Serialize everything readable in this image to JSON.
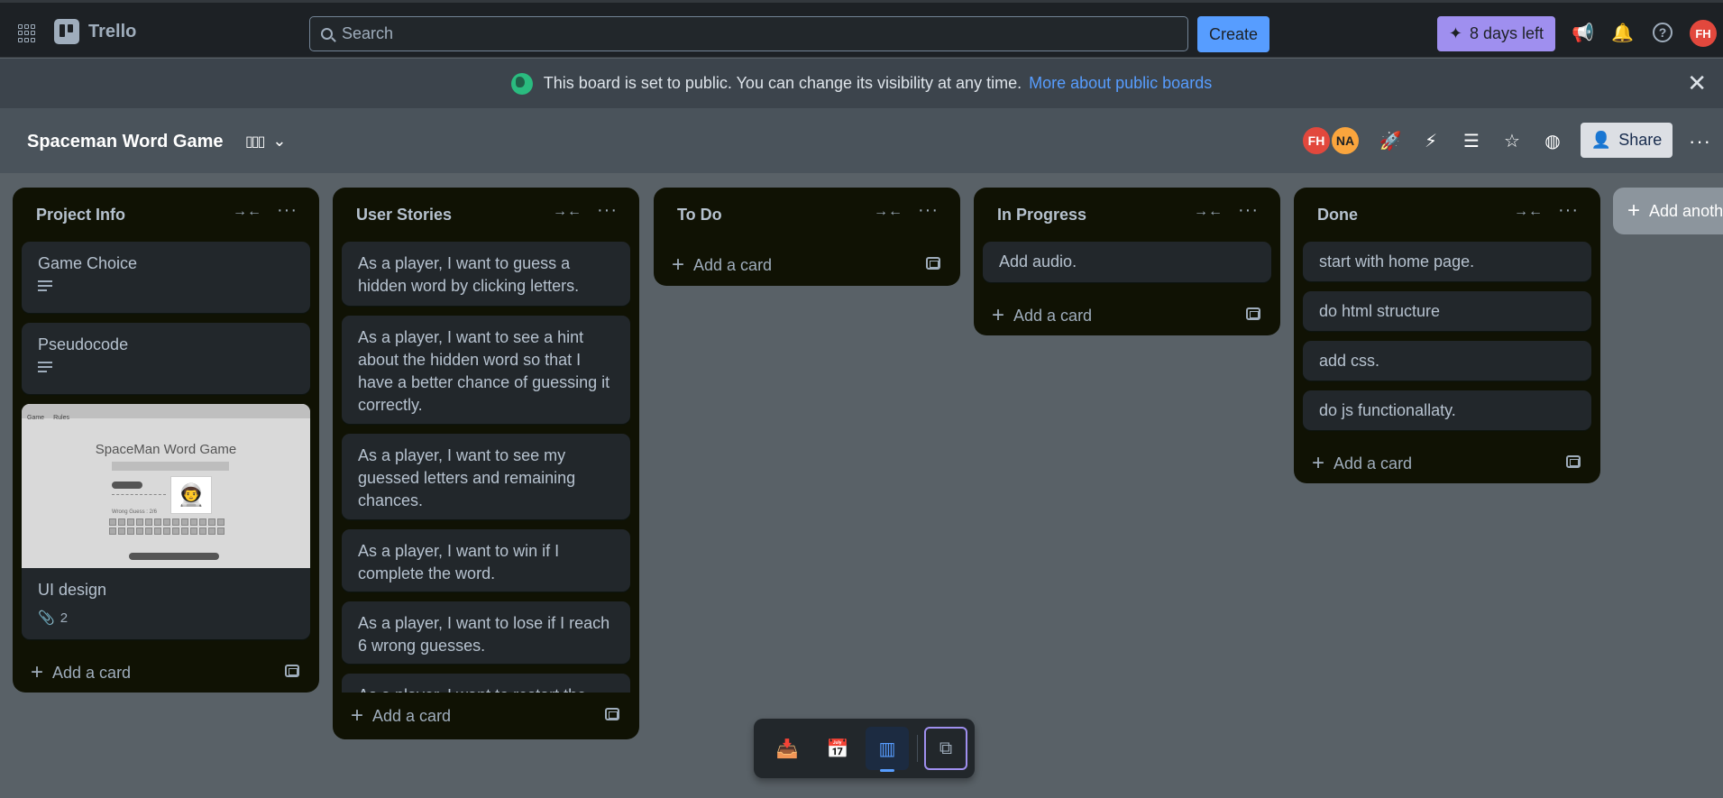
{
  "topbar": {
    "app_name": "Trello",
    "search_placeholder": "Search",
    "create_label": "Create",
    "trial_label": "8 days left",
    "user_initials": "FH"
  },
  "banner": {
    "text": "This board is set to public. You can change its visibility at any time.",
    "link": "More about public boards"
  },
  "board": {
    "title": "Spaceman Word Game",
    "members": [
      {
        "initials": "FH",
        "color": "#e2483d"
      },
      {
        "initials": "NA",
        "color": "#faa53d"
      }
    ],
    "share_label": "Share"
  },
  "lists": [
    {
      "title": "Project Info",
      "cards": [
        {
          "title": "Game Choice"
        },
        {
          "title": "Pseudocode"
        },
        {
          "title": "UI design",
          "attachments": "2"
        }
      ],
      "cover": {
        "menu": [
          "Game",
          "Rules"
        ],
        "title": "SpaceMan Word Game",
        "wrong": "Wrong Guess : 2/6",
        "restart": "Restart Game"
      },
      "add_label": "Add a card"
    },
    {
      "title": "User Stories",
      "cards": [
        {
          "title": "As a player, I want to guess a hidden word by clicking letters."
        },
        {
          "title": "As a player, I want to see a hint about the hidden word so that I have a better chance of guessing it correctly."
        },
        {
          "title": "As a player, I want to see my guessed letters and remaining chances."
        },
        {
          "title": "As a player, I want to win if I complete the word."
        },
        {
          "title": "As a player, I want to lose if I reach 6 wrong guesses."
        },
        {
          "title": "As a player, I want to restart the"
        }
      ],
      "add_label": "Add a card"
    },
    {
      "title": "To Do",
      "cards": [],
      "add_label": "Add a card"
    },
    {
      "title": "In Progress",
      "cards": [
        {
          "title": "Add audio."
        }
      ],
      "add_label": "Add a card"
    },
    {
      "title": "Done",
      "cards": [
        {
          "title": "start with home page."
        },
        {
          "title": "do html structure"
        },
        {
          "title": "add css."
        },
        {
          "title": "do js functionallaty."
        }
      ],
      "add_label": "Add a card"
    }
  ],
  "add_list_label": "Add anoth",
  "switcher": {
    "items": [
      "inbox-icon",
      "calendar-icon",
      "board-icon",
      "switch-boards-icon"
    ],
    "active": "board-icon"
  }
}
